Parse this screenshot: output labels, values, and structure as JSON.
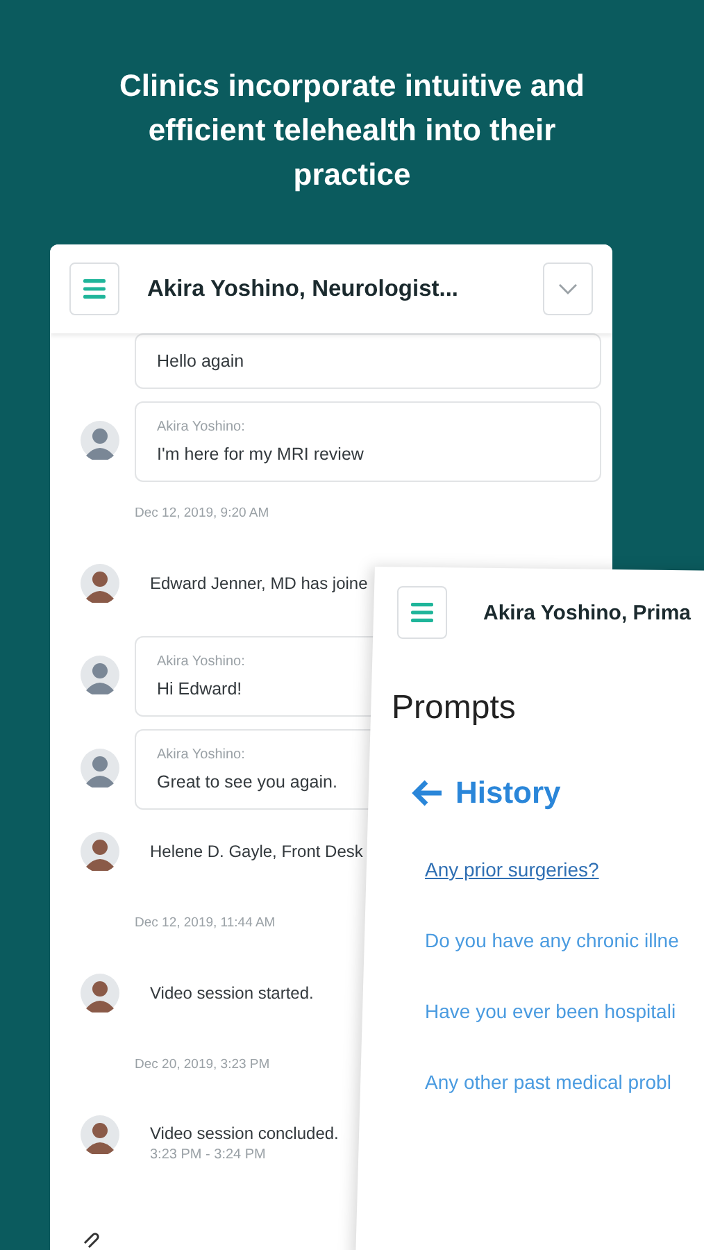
{
  "headline": "Clinics incorporate intuitive and efficient telehealth into their practice",
  "chat_screen": {
    "title": "Akira Yoshino, Neurologist...",
    "messages": [
      {
        "kind": "bubble",
        "text": "Hello again"
      },
      {
        "kind": "bubble",
        "sender": "Akira Yoshino:",
        "text": "I'm here for my MRI review"
      },
      {
        "kind": "date",
        "text": "Dec 12, 2019, 9:20 AM"
      },
      {
        "kind": "event",
        "text": "Edward Jenner, MD has joine"
      },
      {
        "kind": "bubble",
        "sender": "Akira Yoshino:",
        "text": "Hi Edward!"
      },
      {
        "kind": "bubble",
        "sender": "Akira Yoshino:",
        "text": "Great to see you again."
      },
      {
        "kind": "event",
        "text": "Helene D. Gayle, Front Desk"
      },
      {
        "kind": "date",
        "text": "Dec 12, 2019, 11:44 AM"
      },
      {
        "kind": "event",
        "text": "Video session started."
      },
      {
        "kind": "date",
        "text": "Dec 20, 2019, 3:23 PM"
      },
      {
        "kind": "event",
        "text": "Video session concluded.",
        "detail": "3:23 PM - 3:24 PM"
      }
    ]
  },
  "prompts_screen": {
    "title": "Akira Yoshino, Prima",
    "heading": "Prompts",
    "section": "History",
    "prompts": [
      {
        "text": "Any prior surgeries?",
        "selected": true
      },
      {
        "text": "Do you have any chronic illne",
        "selected": false
      },
      {
        "text": "Have you ever been hospitali",
        "selected": false
      },
      {
        "text": "Any other past medical probl",
        "selected": false
      }
    ]
  }
}
